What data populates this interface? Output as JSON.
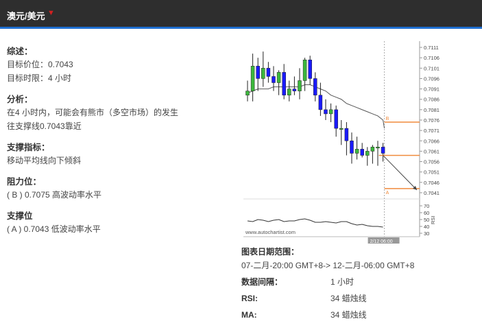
{
  "header": {
    "title": "澳元/美元",
    "caret_icon": "caret-down-icon",
    "accent": "#1f6fd1"
  },
  "summary": {
    "title": "综述：",
    "target_price": "目标价位：0.7043",
    "target_time": "目标时限：4 小时"
  },
  "analysis": {
    "title": "分析：",
    "line1": "在4 小时内，可能会有熊市（多空市场）的发生",
    "line2": "往支撑线0.7043靠近"
  },
  "indicators": {
    "title": "支撑指标：",
    "line1": "移动平均线向下倾斜"
  },
  "resistance": {
    "title": "阻力位：",
    "line1": "( B ) 0.7075 高波动率水平"
  },
  "support": {
    "title": "支撑位",
    "line1": "( A ) 0.7043 低波动率水平"
  },
  "chart_info": {
    "range_title": "图表日期范围：",
    "range_value": "07-二月-20:00 GMT+8-> 12-二月-06:00 GMT+8",
    "interval_label": "数据间隔：",
    "interval_value": "1 小时",
    "rsi_label": "RSI:",
    "rsi_value": "34 蜡烛线",
    "ma_label": "MA:",
    "ma_value": "34 蜡烛线"
  },
  "chart_data": {
    "type": "candlestick",
    "price_ticks": [
      "0.7111",
      "0.7106",
      "0.7101",
      "0.7096",
      "0.7091",
      "0.7086",
      "0.7081",
      "0.7076",
      "0.7071",
      "0.7066",
      "0.7061",
      "0.7056",
      "0.7051",
      "0.7046",
      "0.7041"
    ],
    "ylim": [
      0.7038,
      0.7114
    ],
    "rsi_ticks": [
      "70",
      "60",
      "50",
      "40",
      "30"
    ],
    "rsi_label": "RSI",
    "rsi_ylim": [
      25,
      75
    ],
    "watermark": "www.autochartist.com",
    "time_label": "2/12 06:00",
    "level_B": {
      "label": "B",
      "value": 0.7075
    },
    "level_A": {
      "label": "A",
      "value": 0.7043
    },
    "candles": [
      {
        "o": 0.7088,
        "h": 0.7095,
        "l": 0.7085,
        "c": 0.709
      },
      {
        "o": 0.709,
        "h": 0.7108,
        "l": 0.7085,
        "c": 0.7102
      },
      {
        "o": 0.7102,
        "h": 0.7106,
        "l": 0.709,
        "c": 0.7096
      },
      {
        "o": 0.7096,
        "h": 0.7109,
        "l": 0.7092,
        "c": 0.7101
      },
      {
        "o": 0.7101,
        "h": 0.7104,
        "l": 0.7094,
        "c": 0.7097
      },
      {
        "o": 0.7097,
        "h": 0.7102,
        "l": 0.709,
        "c": 0.7094
      },
      {
        "o": 0.7094,
        "h": 0.71,
        "l": 0.7088,
        "c": 0.7099
      },
      {
        "o": 0.7099,
        "h": 0.7103,
        "l": 0.7086,
        "c": 0.7088
      },
      {
        "o": 0.7088,
        "h": 0.7095,
        "l": 0.7085,
        "c": 0.7091
      },
      {
        "o": 0.7091,
        "h": 0.7097,
        "l": 0.7088,
        "c": 0.709
      },
      {
        "o": 0.709,
        "h": 0.7101,
        "l": 0.7086,
        "c": 0.7095
      },
      {
        "o": 0.7095,
        "h": 0.7106,
        "l": 0.709,
        "c": 0.7105
      },
      {
        "o": 0.7105,
        "h": 0.7107,
        "l": 0.7093,
        "c": 0.7096
      },
      {
        "o": 0.7096,
        "h": 0.7099,
        "l": 0.7085,
        "c": 0.7088
      },
      {
        "o": 0.7088,
        "h": 0.7094,
        "l": 0.7078,
        "c": 0.7081
      },
      {
        "o": 0.7081,
        "h": 0.7086,
        "l": 0.7076,
        "c": 0.7079
      },
      {
        "o": 0.7079,
        "h": 0.7084,
        "l": 0.7075,
        "c": 0.7081
      },
      {
        "o": 0.7081,
        "h": 0.7083,
        "l": 0.7068,
        "c": 0.7072
      },
      {
        "o": 0.7072,
        "h": 0.7076,
        "l": 0.7064,
        "c": 0.7072
      },
      {
        "o": 0.7072,
        "h": 0.7075,
        "l": 0.7059,
        "c": 0.7066
      },
      {
        "o": 0.7066,
        "h": 0.707,
        "l": 0.7055,
        "c": 0.706
      },
      {
        "o": 0.706,
        "h": 0.7068,
        "l": 0.7057,
        "c": 0.7062
      },
      {
        "o": 0.7062,
        "h": 0.7065,
        "l": 0.7058,
        "c": 0.7059
      },
      {
        "o": 0.7059,
        "h": 0.7063,
        "l": 0.7054,
        "c": 0.7061
      },
      {
        "o": 0.7061,
        "h": 0.7064,
        "l": 0.7055,
        "c": 0.7063
      },
      {
        "o": 0.7063,
        "h": 0.7066,
        "l": 0.7054,
        "c": 0.7063
      },
      {
        "o": 0.7063,
        "h": 0.7065,
        "l": 0.7056,
        "c": 0.706
      }
    ],
    "ma": [
      0.7089,
      0.709,
      0.7091,
      0.7091,
      0.7091,
      0.7092,
      0.7092,
      0.7092,
      0.7092,
      0.7092,
      0.7092,
      0.7093,
      0.7093,
      0.7092,
      0.7091,
      0.709,
      0.7088,
      0.7087,
      0.7086,
      0.7084,
      0.7083,
      0.7082,
      0.7081,
      0.708,
      0.7079,
      0.7078,
      0.7076
    ],
    "rsi": [
      48,
      47,
      50,
      49,
      47,
      49,
      50,
      47,
      48,
      48,
      50,
      51,
      49,
      46,
      46,
      47,
      46,
      45,
      47,
      47,
      44,
      42,
      43,
      41,
      40,
      40,
      39
    ]
  }
}
